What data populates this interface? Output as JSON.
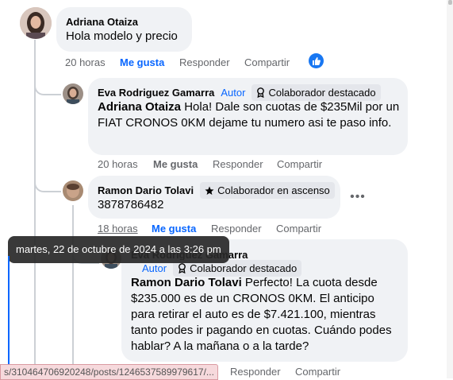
{
  "comments": [
    {
      "author": "Adriana Otaiza",
      "text": "Hola modelo y precio",
      "time": "20 horas",
      "like_label": "Me gusta",
      "reply_label": "Responder",
      "share_label": "Compartir"
    },
    {
      "author": "Eva Rodriguez Gamarra",
      "role": "Autor",
      "badge": "Colaborador destacado",
      "mention": "Adriana Otaiza",
      "text": " Hola! Dale son cuotas de $235Mil por un FIAT CRONOS 0KM dejame tu numero asi te paso info.",
      "time": "20 horas",
      "like_label": "Me gusta",
      "reply_label": "Responder",
      "share_label": "Compartir"
    },
    {
      "author": "Ramon Dario Tolavi",
      "badge": "Colaborador en ascenso",
      "text": "3878786482",
      "time": "18 horas",
      "like_label": "Me gusta",
      "reply_label": "Responder",
      "share_label": "Compartir"
    },
    {
      "author": "Eva Rodriguez Gamarra",
      "role": "Autor",
      "badge": "Colaborador destacado",
      "mention": "Ramon Dario Tolavi",
      "text": " Perfecto! La cuota desde $235.000 es de un CRONOS 0KM. El anticipo para retirar el auto es de $7.421.100, mientras tanto podes ir pagando en cuotas. Cuándo podes hablar? A la mañana o a la tarde?",
      "reply_label": "Responder",
      "share_label": "Compartir"
    }
  ],
  "tooltip": "martes, 22 de octubre de 2024 a las 3:26 pm",
  "status_url": "s/310464706920248/posts/1246537589979617/...",
  "colors": {
    "accent": "#0866ff",
    "bubble": "#f0f2f5",
    "meta": "#65676b"
  }
}
